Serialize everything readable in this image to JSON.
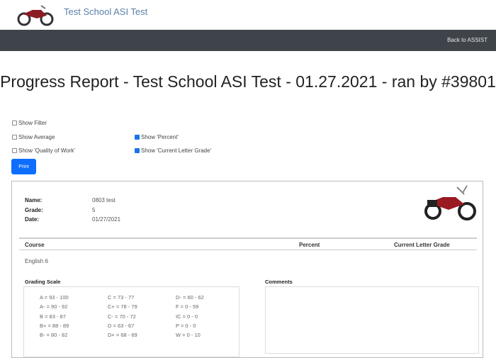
{
  "header": {
    "brand": "Test School ASI Test",
    "back_link": "Back to ASSIST",
    "logo_icon": "motorcycle-icon"
  },
  "title": "Progress Report - Test School ASI Test - 01.27.2021 - ran by #39801",
  "options": [
    {
      "label": "Show Filter",
      "checked": false
    },
    {
      "label": "Show Average",
      "checked": false
    },
    {
      "label": "Show 'Quality of Work'",
      "checked": false
    },
    {
      "label": "Show 'Percent'",
      "checked": true
    },
    {
      "label": "Show 'Current Letter Grade'",
      "checked": true
    }
  ],
  "print_label": "Print",
  "report": {
    "name_label": "Name:",
    "name": "0803 test",
    "grade_label": "Grade:",
    "grade": "5",
    "date_label": "Date:",
    "date": "01/27/2021",
    "columns": [
      "Course",
      "Percent",
      "Current Letter Grade"
    ],
    "courses": [
      "English 6"
    ],
    "grading_scale_title": "Grading Scale",
    "comments_title": "Comments",
    "grading_scale": [
      [
        "A = 93 - 100",
        "A- = 90 - 92",
        "B = 83 - 87",
        "B+ = 88 - 89",
        "B- = 80 - 82"
      ],
      [
        "C = 73 - 77",
        "C+ = 78 - 79",
        "C- = 70 - 72",
        "D = 63 - 67",
        "D+ = 68 - 69"
      ],
      [
        "D- = 60 - 62",
        "F = 0 - 59",
        "IC = 0 - 0",
        "P = 0 - 0",
        "W = 0 - 10"
      ]
    ]
  }
}
